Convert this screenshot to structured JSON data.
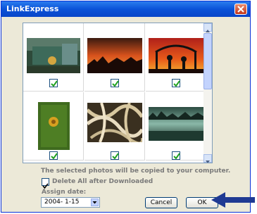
{
  "window": {
    "title": "LinkExpress"
  },
  "photos": [
    {
      "name": "green-truck",
      "checked": true
    },
    {
      "name": "desert-sunset",
      "checked": true
    },
    {
      "name": "silhouette-gate",
      "checked": true
    },
    {
      "name": "green-leaf-flower",
      "checked": true
    },
    {
      "name": "tangled-roots",
      "checked": true
    },
    {
      "name": "misty-river",
      "checked": true
    }
  ],
  "info_text": "The selected photos will be copied to your computer.",
  "delete_option": {
    "label": "Delete All after Downloaded",
    "checked": true
  },
  "assign_date": {
    "label": "Assign date:",
    "value": "2004- 1-15"
  },
  "buttons": {
    "cancel": "Cancel",
    "ok": "OK"
  },
  "colors": {
    "titlebar": "#0a52d8",
    "arrow": "#1f3a93"
  }
}
